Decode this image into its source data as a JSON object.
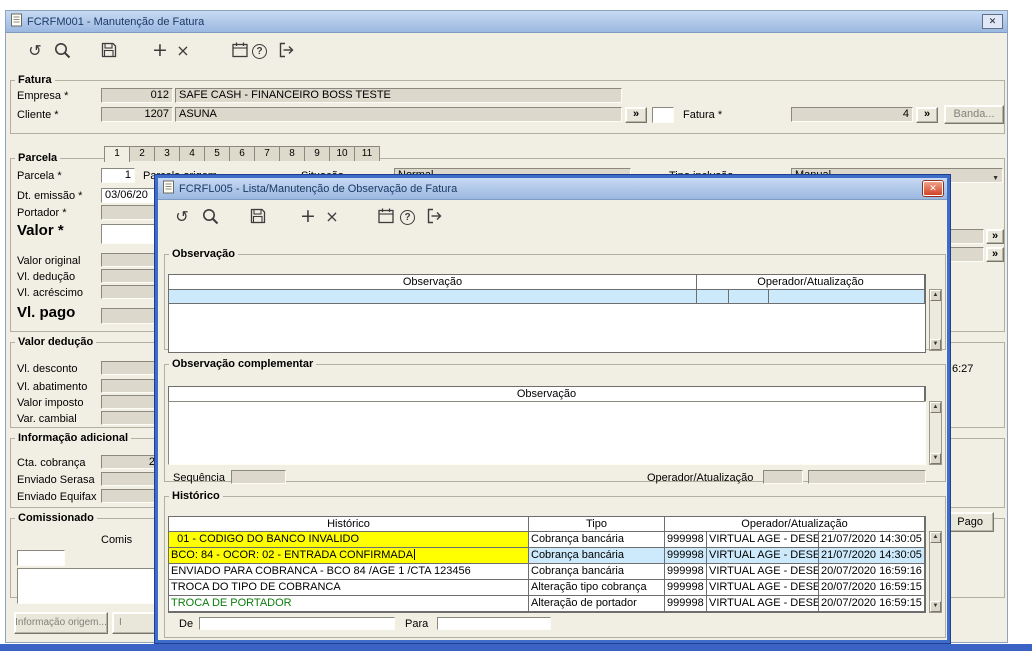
{
  "colors": {
    "highlight_yellow": "#ffff00",
    "selected_row_blue": "#cdeafc",
    "green_text": "#0a7d0a",
    "titlebar_blue": "#9bb8e0",
    "modal_border_blue": "#3f6cc8"
  },
  "toolbar_icons": [
    "undo",
    "search",
    "save",
    "add",
    "delete",
    "calendar",
    "help",
    "exit"
  ],
  "main_window": {
    "title": "FCRFM001 - Manutenção de Fatura",
    "fatura": {
      "legend": "Fatura",
      "empresa_label": "Empresa *",
      "empresa_code": "012",
      "empresa_name": "SAFE CASH - FINANCEIRO BOSS TESTE",
      "cliente_label": "Cliente *",
      "cliente_code": "1207",
      "cliente_name": "ASUNA",
      "fatura_label": "Fatura *",
      "fatura_number": "4",
      "banda_button": "Banda..."
    },
    "parcela": {
      "legend": "Parcela",
      "tabs": [
        "1",
        "2",
        "3",
        "4",
        "5",
        "6",
        "7",
        "8",
        "9",
        "10",
        "11"
      ],
      "parcela_label": "Parcela *",
      "parcela_value": "1",
      "parcela_origem_label": "Parcela origem",
      "situacao_label": "Situação",
      "situacao_value": "Normal",
      "tipo_inclusao_label": "Tipo inclusão",
      "tipo_inclusao_value": "Manual",
      "dt_emissao_label": "Dt. emissão *",
      "dt_emissao_value": "03/06/20",
      "portador_label": "Portador *",
      "valor_label": "Valor *",
      "valor_original_label": "Valor original",
      "vl_deducao_label": "Vl. dedução",
      "vl_acrescimo_label": "Vl. acréscimo",
      "vl_pago_label": "Vl. pago"
    },
    "valor_deducao": {
      "legend": "Valor dedução",
      "vl_desconto_label": "Vl. desconto",
      "vl_abatimento_label": "Vl. abatimento",
      "valor_imposto_label": "Valor imposto",
      "var_cambial_label": "Var. cambial"
    },
    "info_adicional": {
      "legend": "Informação adicional",
      "cta_cobranca_label": "Cta. cobrança",
      "cta_cobranca_value": "2",
      "enviado_serasa_label": "Enviado Serasa",
      "enviado_equifax_label": "Enviado Equifax"
    },
    "comissionado": {
      "legend": "Comissionado",
      "comis_label": "Comis"
    },
    "bottom_buttons": {
      "informacao_origem": "Informação origem...",
      "partial": "I"
    },
    "fragments": {
      "time": "6:27",
      "pago": "Pago"
    }
  },
  "modal": {
    "title": "FCRFL005 - Lista/Manutenção de Observação de Fatura",
    "observacao": {
      "legend": "Observação",
      "col_observacao": "Observação",
      "col_operador": "Operador/Atualização"
    },
    "observacao_complementar": {
      "legend": "Observação complementar",
      "col_observacao": "Observação",
      "sequencia_label": "Sequência",
      "operador_label": "Operador/Atualização"
    },
    "historico": {
      "legend": "Histórico",
      "col_historico": "Histórico",
      "col_tipo": "Tipo",
      "col_operador": "Operador/Atualização",
      "de_label": "De",
      "para_label": "Para",
      "rows": [
        {
          "historico": "  01 - CODIGO DO BANCO INVALIDO",
          "tipo": "Cobrança bancária",
          "op_code": "999998",
          "op_name": "VIRTUAL AGE - DESE",
          "op_datetime": "21/07/2020 14:30:05"
        },
        {
          "historico": "BCO: 84 - OCOR: 02 - ENTRADA CONFIRMADA",
          "tipo": "Cobrança bancária",
          "op_code": "999998",
          "op_name": "VIRTUAL AGE - DESE",
          "op_datetime": "21/07/2020 14:30:05"
        },
        {
          "historico": "ENVIADO PARA COBRANCA - BCO 84 /AGE 1 /CTA 123456",
          "tipo": "Cobrança bancária",
          "op_code": "999998",
          "op_name": "VIRTUAL AGE - DESE",
          "op_datetime": "20/07/2020 16:59:16"
        },
        {
          "historico": "TROCA DO TIPO DE COBRANCA",
          "tipo": "Alteração tipo cobrança",
          "op_code": "999998",
          "op_name": "VIRTUAL AGE - DESE",
          "op_datetime": "20/07/2020 16:59:15"
        },
        {
          "historico": "TROCA DE PORTADOR",
          "tipo": "Alteração de portador",
          "op_code": "999998",
          "op_name": "VIRTUAL AGE - DESE",
          "op_datetime": "20/07/2020 16:59:15"
        }
      ]
    }
  }
}
